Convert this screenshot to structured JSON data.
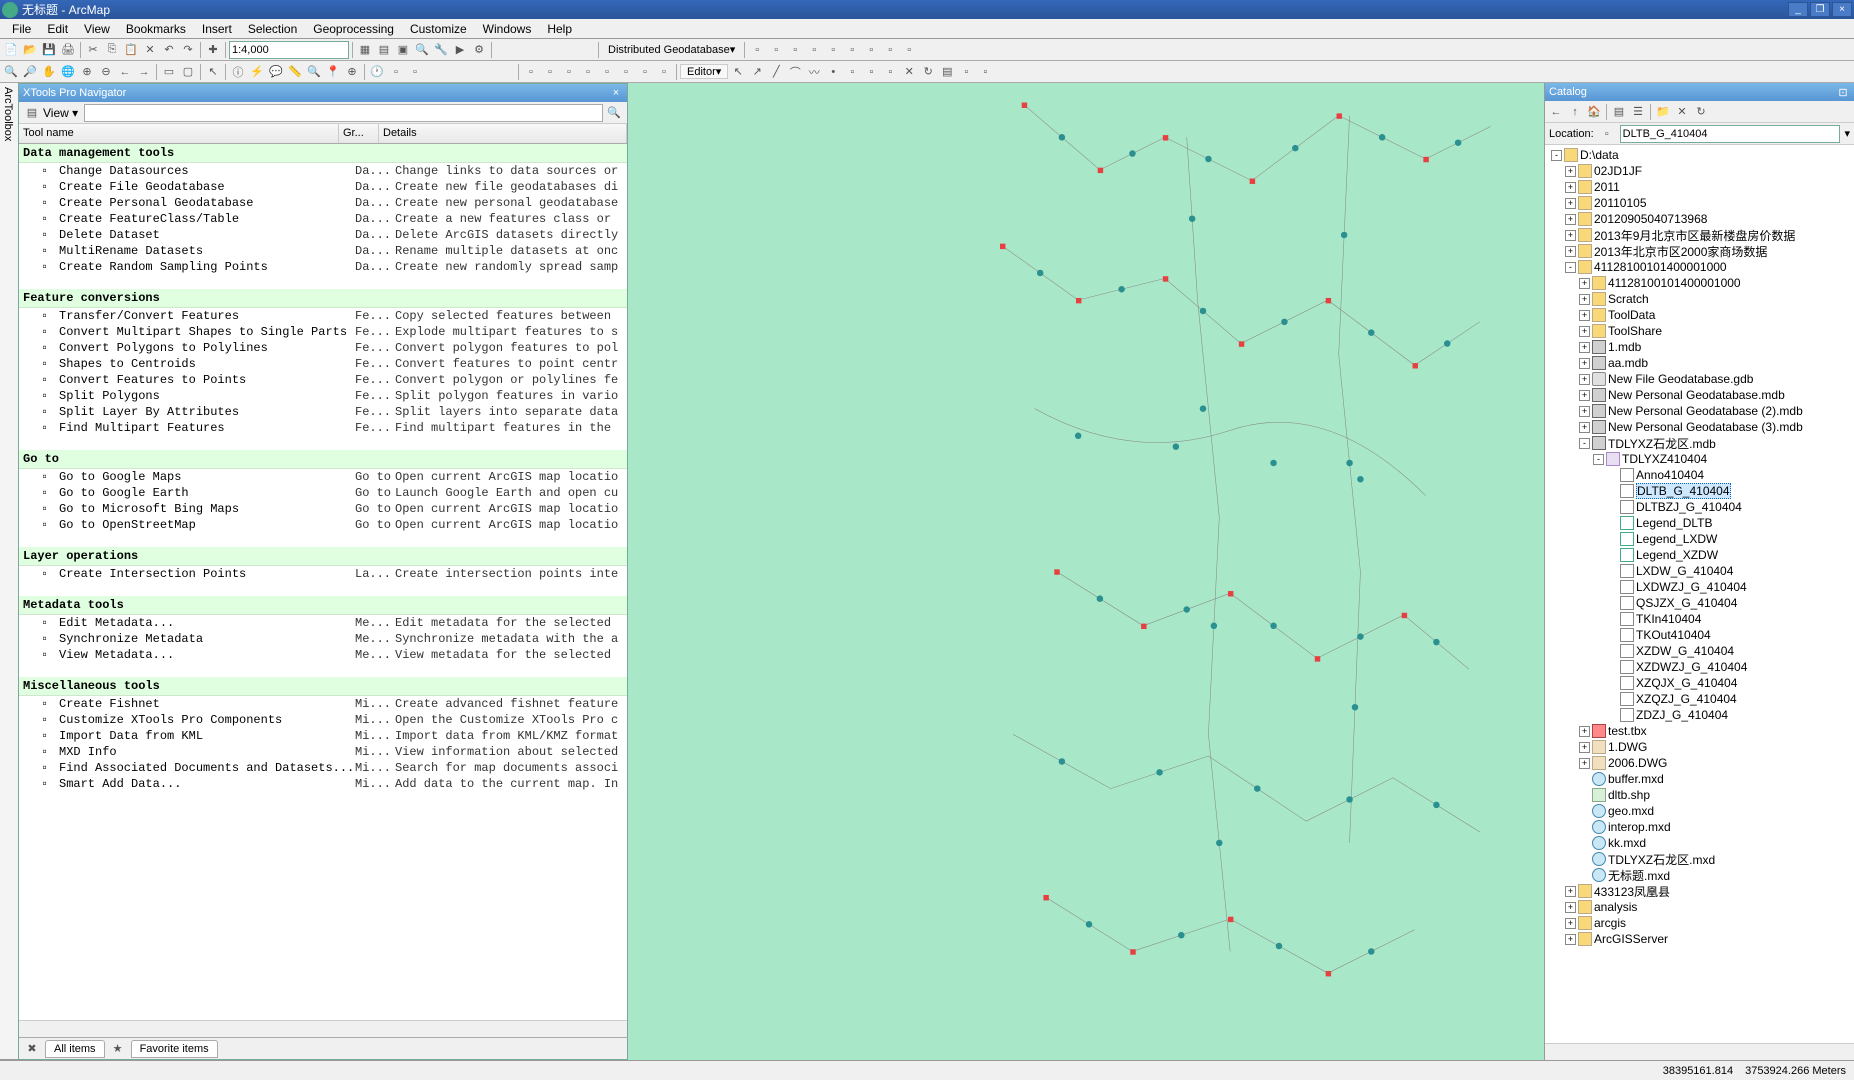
{
  "title": "无标题 - ArcMap",
  "menus": [
    "File",
    "Edit",
    "View",
    "Bookmarks",
    "Insert",
    "Selection",
    "Geoprocessing",
    "Customize",
    "Windows",
    "Help"
  ],
  "scale": "1:4,000",
  "distributed_label": "Distributed Geodatabase▾",
  "editor_label": "Editor▾",
  "navigator": {
    "title": "XTools Pro Navigator",
    "view_label": "View ▾",
    "headers": {
      "name": "Tool name",
      "gr": "Gr...",
      "det": "Details"
    },
    "tabs": {
      "all": "All items",
      "fav": "Favorite items"
    }
  },
  "sections": [
    {
      "title": "Data management tools",
      "items": [
        {
          "n": "Change Datasources",
          "g": "Da...",
          "d": "Change links to data sources or"
        },
        {
          "n": "Create File Geodatabase",
          "g": "Da...",
          "d": "Create new file geodatabases di"
        },
        {
          "n": "Create Personal Geodatabase",
          "g": "Da...",
          "d": "Create new personal geodatabase"
        },
        {
          "n": "Create FeatureClass/Table",
          "g": "Da...",
          "d": "Create a new features class or"
        },
        {
          "n": "Delete Dataset",
          "g": "Da...",
          "d": "Delete ArcGIS datasets directly"
        },
        {
          "n": "MultiRename Datasets",
          "g": "Da...",
          "d": "Rename multiple datasets at onc"
        },
        {
          "n": "Create Random Sampling Points",
          "g": "Da...",
          "d": "Create new randomly spread samp"
        }
      ]
    },
    {
      "title": "Feature conversions",
      "items": [
        {
          "n": "Transfer/Convert Features",
          "g": "Fe...",
          "d": "Copy selected features between"
        },
        {
          "n": "Convert Multipart Shapes to Single Parts",
          "g": "Fe...",
          "d": "Explode multipart features to s"
        },
        {
          "n": "Convert Polygons to Polylines",
          "g": "Fe...",
          "d": "Convert polygon features to pol"
        },
        {
          "n": "Shapes to Centroids",
          "g": "Fe...",
          "d": "Convert features to point centr"
        },
        {
          "n": "Convert Features to Points",
          "g": "Fe...",
          "d": "Convert polygon or polylines fe"
        },
        {
          "n": "Split Polygons",
          "g": "Fe...",
          "d": "Split polygon features in vario"
        },
        {
          "n": "Split Layer By Attributes",
          "g": "Fe...",
          "d": "Split layers into separate data"
        },
        {
          "n": "Find Multipart Features",
          "g": "Fe...",
          "d": "Find multipart features in the"
        }
      ]
    },
    {
      "title": "Go to",
      "items": [
        {
          "n": "Go to Google Maps",
          "g": "Go to",
          "d": "Open current ArcGIS map locatio"
        },
        {
          "n": "Go to Google Earth",
          "g": "Go to",
          "d": "Launch Google Earth and open cu"
        },
        {
          "n": "Go to Microsoft Bing Maps",
          "g": "Go to",
          "d": "Open current ArcGIS map locatio"
        },
        {
          "n": "Go to OpenStreetMap",
          "g": "Go to",
          "d": "Open current ArcGIS map locatio"
        }
      ]
    },
    {
      "title": "Layer operations",
      "items": [
        {
          "n": "Create Intersection Points",
          "g": "La...",
          "d": "Create intersection points inte"
        }
      ]
    },
    {
      "title": "Metadata tools",
      "items": [
        {
          "n": "Edit Metadata...",
          "g": "Me...",
          "d": "Edit metadata for the selected"
        },
        {
          "n": "Synchronize Metadata",
          "g": "Me...",
          "d": "Synchronize metadata with the a"
        },
        {
          "n": "View Metadata...",
          "g": "Me...",
          "d": "View metadata for the selected"
        }
      ]
    },
    {
      "title": "Miscellaneous tools",
      "items": [
        {
          "n": "Create Fishnet",
          "g": "Mi...",
          "d": "Create advanced fishnet feature"
        },
        {
          "n": "Customize XTools Pro Components",
          "g": "Mi...",
          "d": "Open the Customize XTools Pro c"
        },
        {
          "n": "Import Data from KML",
          "g": "Mi...",
          "d": "Import data from KML/KMZ format"
        },
        {
          "n": "MXD Info",
          "g": "Mi...",
          "d": "View information about selected"
        },
        {
          "n": "Find Associated Documents and Datasets...",
          "g": "Mi...",
          "d": "Search for map documents associ"
        },
        {
          "n": "Smart Add Data...",
          "g": "Mi...",
          "d": "Add data to the current map. In"
        }
      ]
    }
  ],
  "catalog": {
    "title": "Catalog",
    "location_label": "Location:",
    "location_value": "DLTB_G_410404"
  },
  "catalog_tree": [
    {
      "lvl": 0,
      "t": "-",
      "ic": "folder",
      "n": "D:\\data"
    },
    {
      "lvl": 1,
      "t": "+",
      "ic": "folder",
      "n": "02JD1JF"
    },
    {
      "lvl": 1,
      "t": "+",
      "ic": "folder",
      "n": "2011"
    },
    {
      "lvl": 1,
      "t": "+",
      "ic": "folder",
      "n": "20110105"
    },
    {
      "lvl": 1,
      "t": "+",
      "ic": "folder",
      "n": "20120905040713968"
    },
    {
      "lvl": 1,
      "t": "+",
      "ic": "folder",
      "n": "2013年9月北京市区最新楼盘房价数据"
    },
    {
      "lvl": 1,
      "t": "+",
      "ic": "folder",
      "n": "2013年北京市区2000家商场数据"
    },
    {
      "lvl": 1,
      "t": "-",
      "ic": "folder",
      "n": "41128100101400001000"
    },
    {
      "lvl": 2,
      "t": "+",
      "ic": "folder",
      "n": "41128100101400001000"
    },
    {
      "lvl": 2,
      "t": "+",
      "ic": "folder",
      "n": "Scratch"
    },
    {
      "lvl": 2,
      "t": "+",
      "ic": "folder",
      "n": "ToolData"
    },
    {
      "lvl": 2,
      "t": "+",
      "ic": "folder",
      "n": "ToolShare"
    },
    {
      "lvl": 2,
      "t": "+",
      "ic": "mdb",
      "n": "1.mdb"
    },
    {
      "lvl": 2,
      "t": "+",
      "ic": "mdb",
      "n": "aa.mdb"
    },
    {
      "lvl": 2,
      "t": "+",
      "ic": "gdb",
      "n": "New File Geodatabase.gdb"
    },
    {
      "lvl": 2,
      "t": "+",
      "ic": "mdb",
      "n": "New Personal Geodatabase.mdb"
    },
    {
      "lvl": 2,
      "t": "+",
      "ic": "mdb",
      "n": "New Personal Geodatabase (2).mdb"
    },
    {
      "lvl": 2,
      "t": "+",
      "ic": "mdb",
      "n": "New Personal Geodatabase (3).mdb"
    },
    {
      "lvl": 2,
      "t": "-",
      "ic": "mdb",
      "n": "TDLYXZ石龙区.mdb"
    },
    {
      "lvl": 3,
      "t": "-",
      "ic": "dataset",
      "n": "TDLYXZ410404"
    },
    {
      "lvl": 4,
      "t": "",
      "ic": "fc",
      "n": "Anno410404"
    },
    {
      "lvl": 4,
      "t": "",
      "ic": "fc",
      "n": "DLTB_G_410404",
      "sel": true
    },
    {
      "lvl": 4,
      "t": "",
      "ic": "fc",
      "n": "DLTBZJ_G_410404"
    },
    {
      "lvl": 4,
      "t": "",
      "ic": "table",
      "n": "Legend_DLTB"
    },
    {
      "lvl": 4,
      "t": "",
      "ic": "table",
      "n": "Legend_LXDW"
    },
    {
      "lvl": 4,
      "t": "",
      "ic": "table",
      "n": "Legend_XZDW"
    },
    {
      "lvl": 4,
      "t": "",
      "ic": "fc",
      "n": "LXDW_G_410404"
    },
    {
      "lvl": 4,
      "t": "",
      "ic": "fc",
      "n": "LXDWZJ_G_410404"
    },
    {
      "lvl": 4,
      "t": "",
      "ic": "fc",
      "n": "QSJZX_G_410404"
    },
    {
      "lvl": 4,
      "t": "",
      "ic": "fc",
      "n": "TKIn410404"
    },
    {
      "lvl": 4,
      "t": "",
      "ic": "fc",
      "n": "TKOut410404"
    },
    {
      "lvl": 4,
      "t": "",
      "ic": "fc",
      "n": "XZDW_G_410404"
    },
    {
      "lvl": 4,
      "t": "",
      "ic": "fc",
      "n": "XZDWZJ_G_410404"
    },
    {
      "lvl": 4,
      "t": "",
      "ic": "fc",
      "n": "XZQJX_G_410404"
    },
    {
      "lvl": 4,
      "t": "",
      "ic": "fc",
      "n": "XZQZJ_G_410404"
    },
    {
      "lvl": 4,
      "t": "",
      "ic": "fc",
      "n": "ZDZJ_G_410404"
    },
    {
      "lvl": 2,
      "t": "+",
      "ic": "tbx",
      "n": "test.tbx"
    },
    {
      "lvl": 2,
      "t": "+",
      "ic": "dwg",
      "n": "1.DWG"
    },
    {
      "lvl": 2,
      "t": "+",
      "ic": "dwg",
      "n": "2006.DWG"
    },
    {
      "lvl": 2,
      "t": "",
      "ic": "mxd",
      "n": "buffer.mxd"
    },
    {
      "lvl": 2,
      "t": "",
      "ic": "shp",
      "n": "dltb.shp"
    },
    {
      "lvl": 2,
      "t": "",
      "ic": "mxd",
      "n": "geo.mxd"
    },
    {
      "lvl": 2,
      "t": "",
      "ic": "mxd",
      "n": "interop.mxd"
    },
    {
      "lvl": 2,
      "t": "",
      "ic": "mxd",
      "n": "kk.mxd"
    },
    {
      "lvl": 2,
      "t": "",
      "ic": "mxd",
      "n": "TDLYXZ石龙区.mxd"
    },
    {
      "lvl": 2,
      "t": "",
      "ic": "mxd",
      "n": "无标题.mxd"
    },
    {
      "lvl": 1,
      "t": "+",
      "ic": "folder",
      "n": "433123凤凰县"
    },
    {
      "lvl": 1,
      "t": "+",
      "ic": "folder",
      "n": "analysis"
    },
    {
      "lvl": 1,
      "t": "+",
      "ic": "folder",
      "n": "arcgis"
    },
    {
      "lvl": 1,
      "t": "+",
      "ic": "folder",
      "n": "ArcGISServer"
    }
  ],
  "sidebar_tabs": [
    "ArcToolbox",
    "XTools Pro Navigator"
  ],
  "status": {
    "x": "38395161.814",
    "y": "3753924.266 Meters"
  }
}
